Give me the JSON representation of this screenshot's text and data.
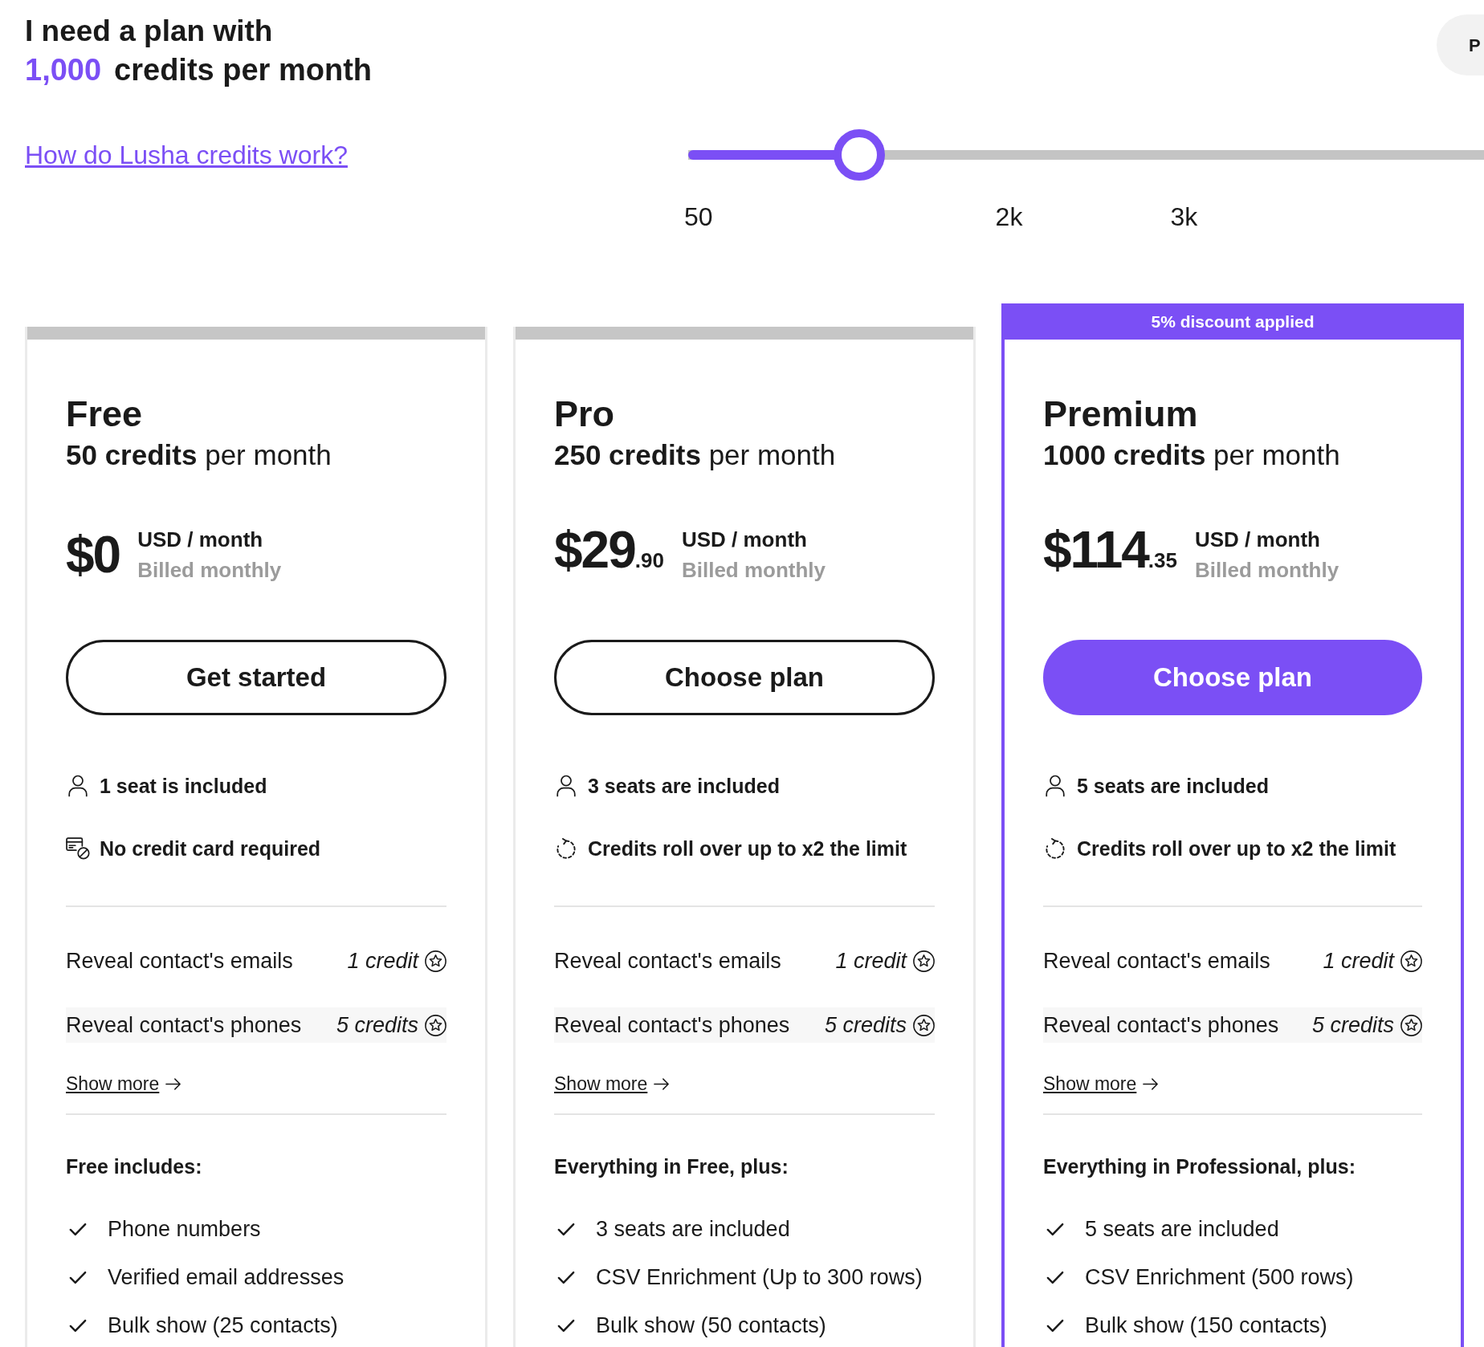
{
  "header": {
    "title": "I need a plan with",
    "credits_value": "1,000",
    "credits_label": "credits per month",
    "help_link": "How do Lusha credits work?",
    "side_button": "P"
  },
  "slider": {
    "level": 0.215,
    "ticks": [
      "50",
      "2k",
      "3k"
    ]
  },
  "plans": [
    {
      "name": "Free",
      "highlighted": false,
      "credits": "**50 credits** per month",
      "price": {
        "amount": "$0",
        "unit": "USD / month",
        "billing": "Billed monthly"
      },
      "button": "Get started",
      "perks": [
        {
          "kind": "seats",
          "text": "1 seat is included"
        },
        {
          "kind": "no_card",
          "text": "No credit card required"
        }
      ],
      "costs": [
        {
          "label": "Reveal contact's emails",
          "cost": "1 credit"
        },
        {
          "label": "Reveal contact's phones",
          "cost": "5 credits"
        }
      ],
      "show_more": "Show more",
      "includes_title": "Free includes:",
      "includes": [
        "Phone numbers",
        "Verified email addresses",
        "Bulk show (25 contacts)"
      ]
    },
    {
      "name": "Pro",
      "highlighted": false,
      "credits": "**250 credits** per month",
      "price": {
        "amount": "$29",
        "cents": ".90",
        "unit": "USD / month",
        "billing": "Billed monthly"
      },
      "button": "Choose plan",
      "perks": [
        {
          "kind": "seats",
          "text": "3 seats are included"
        },
        {
          "kind": "rollover",
          "text": "Credits roll over up to x2 the limit"
        }
      ],
      "costs": [
        {
          "label": "Reveal contact's emails",
          "cost": "1 credit"
        },
        {
          "label": "Reveal contact's phones",
          "cost": "5 credits"
        }
      ],
      "show_more": "Show more",
      "includes_title": "Everything in Free, plus:",
      "includes": [
        "3 seats are included",
        "CSV Enrichment (Up to 300 rows)",
        "Bulk show (50 contacts)"
      ]
    },
    {
      "name": "Premium",
      "highlighted": true,
      "banner": "5% discount applied",
      "credits": "**1000 credits** per month",
      "price": {
        "amount": "$114",
        "cents": ".35",
        "unit": "USD / month",
        "billing": "Billed monthly"
      },
      "button": "Choose plan",
      "perks": [
        {
          "kind": "seats",
          "text": "5 seats are included"
        },
        {
          "kind": "rollover",
          "text": "Credits roll over up to x2 the limit"
        }
      ],
      "costs": [
        {
          "label": "Reveal contact's emails",
          "cost": "1 credit"
        },
        {
          "label": "Reveal contact's phones",
          "cost": "5 credits"
        }
      ],
      "show_more": "Show more",
      "includes_title": "Everything in Professional, plus:",
      "includes": [
        "5 seats are included",
        "CSV Enrichment (500 rows)",
        "Bulk show (150 contacts)"
      ]
    }
  ]
}
